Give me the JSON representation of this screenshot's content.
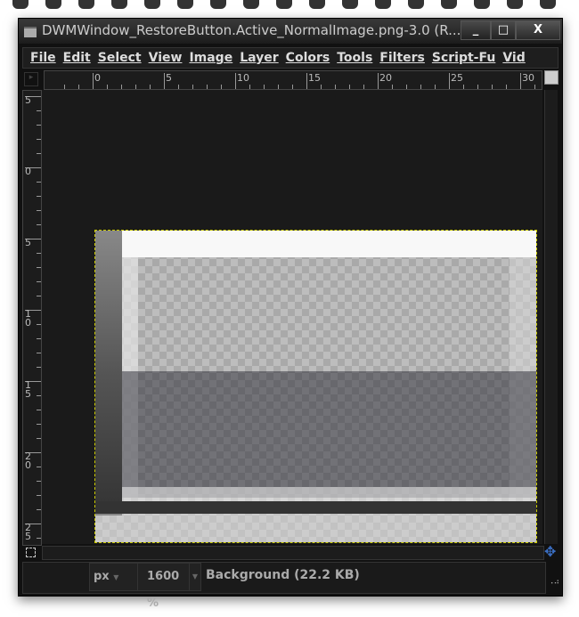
{
  "window": {
    "title": "DWMWindow_RestoreButton.Active_NormalImage.png-3.0 (R...",
    "minimize": "_",
    "maximize": "□",
    "close": "X"
  },
  "menu": [
    "File",
    "Edit",
    "Select",
    "View",
    "Image",
    "Layer",
    "Colors",
    "Tools",
    "Filters",
    "Script-Fu",
    "Vid"
  ],
  "hruler": [
    "0",
    "5",
    "10",
    "15",
    "20",
    "25",
    "30"
  ],
  "vruler": [
    "5",
    "0",
    "5",
    "1\n0",
    "1\n5",
    "2\n0",
    "2\n5"
  ],
  "status": {
    "unit": "px",
    "zoom": "1600 %",
    "info": "Background (22.2 KB)"
  },
  "colors": {
    "selection": "#cccc00",
    "nav": "#3b6fc4"
  }
}
